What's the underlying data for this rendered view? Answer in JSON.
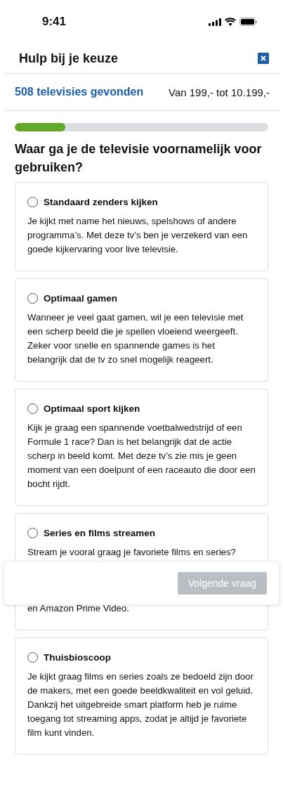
{
  "status_bar": {
    "time": "9:41"
  },
  "header": {
    "title": "Hulp bij je keuze"
  },
  "results": {
    "count": "508 televisies gevonden",
    "price_range": "Van 199,- tot 10.199,-"
  },
  "progress": {
    "level": 0.2
  },
  "question": "Waar ga je de televisie voornamelijk voor gebruiken?",
  "options": [
    {
      "title": "Standaard zenders kijken",
      "selected": false,
      "description": "Je kijkt met name het nieuws, spelshows of andere programma’s. Met deze tv’s ben je verzekerd van een goede kijkervaring voor live televisie."
    },
    {
      "title": "Optimaal gamen",
      "selected": false,
      "description": "Wanneer je veel gaat gamen, wil je een televisie met een scherp beeld die je spellen vloeiend weergeeft. Zeker voor snelle en spannende games is het belangrijk dat de tv zo snel mogelijk reageert."
    },
    {
      "title": "Optimaal sport kijken",
      "selected": false,
      "description": "Kijk je graag een spannende voetbalwedstrijd of een Formule 1 race? Dan is het belangrijk dat de actie scherp in beeld komt. Met deze tv’s zie mis je geen moment van een doelpunt of een raceauto die door een bocht rijdt."
    },
    {
      "title": "Series en films streamen",
      "selected": false,
      "description": "Stream je vooral graag je favoriete films en series?",
      "description_after_overlay": "en Amazon Prime Video."
    },
    {
      "title": "Thuisbioscoop",
      "selected": false,
      "description": "Je kijkt graag films en series zoals ze bedoeld zijn door de makers, met een goede beeldkwaliteit en vol geluid. Dankzij het uitgebreide smart platform heb je ruime toegang tot streaming apps, zodat je altijd je favoriete film kunt vinden."
    }
  ],
  "next_button": {
    "label": "Volgende vraag",
    "disabled": true
  }
}
